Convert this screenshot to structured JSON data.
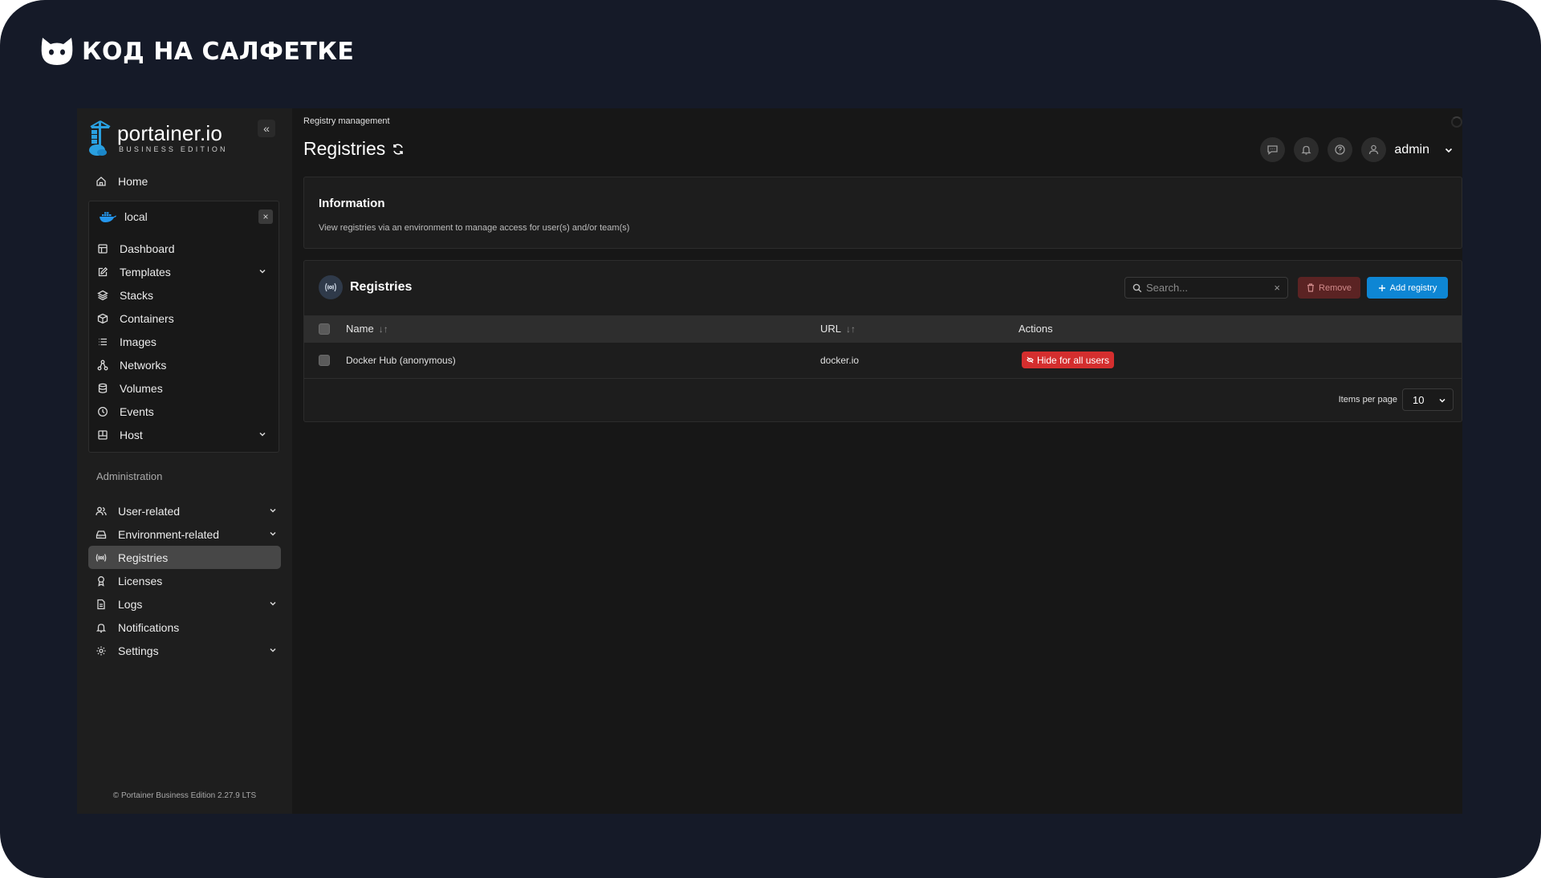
{
  "brand": {
    "text": "КОД НА САЛФЕТКЕ"
  },
  "sidebar": {
    "logo_name": "portainer.io",
    "logo_edition": "BUSINESS EDITION",
    "collapse_icon": "«",
    "home": "Home",
    "environment": {
      "name": "local",
      "close_icon": "×",
      "items": [
        {
          "label": "Dashboard",
          "icon": "dashboard-icon",
          "expandable": false
        },
        {
          "label": "Templates",
          "icon": "edit-icon",
          "expandable": true
        },
        {
          "label": "Stacks",
          "icon": "layers-icon",
          "expandable": false
        },
        {
          "label": "Containers",
          "icon": "box-icon",
          "expandable": false
        },
        {
          "label": "Images",
          "icon": "list-icon",
          "expandable": false
        },
        {
          "label": "Networks",
          "icon": "network-icon",
          "expandable": false
        },
        {
          "label": "Volumes",
          "icon": "database-icon",
          "expandable": false
        },
        {
          "label": "Events",
          "icon": "clock-icon",
          "expandable": false
        },
        {
          "label": "Host",
          "icon": "host-icon",
          "expandable": true
        }
      ]
    },
    "admin_label": "Administration",
    "admin_items": [
      {
        "label": "User-related",
        "icon": "users-icon",
        "expandable": true
      },
      {
        "label": "Environment-related",
        "icon": "drive-icon",
        "expandable": true
      },
      {
        "label": "Registries",
        "icon": "radio-icon",
        "expandable": false,
        "active": true
      },
      {
        "label": "Licenses",
        "icon": "award-icon",
        "expandable": false
      },
      {
        "label": "Logs",
        "icon": "file-icon",
        "expandable": true
      },
      {
        "label": "Notifications",
        "icon": "bell-icon",
        "expandable": false
      },
      {
        "label": "Settings",
        "icon": "gear-icon",
        "expandable": true
      }
    ],
    "footer": "© Portainer Business Edition 2.27.9 LTS"
  },
  "header": {
    "breadcrumb": "Registry management",
    "title": "Registries",
    "user": "admin"
  },
  "info": {
    "title": "Information",
    "text": "View registries via an environment to manage access for user(s) and/or team(s)"
  },
  "registries": {
    "title": "Registries",
    "search_placeholder": "Search...",
    "clear_icon": "×",
    "remove_label": "Remove",
    "add_label": "Add registry",
    "columns": {
      "name": "Name",
      "url": "URL",
      "actions": "Actions"
    },
    "sort_glyph": "↓↑",
    "rows": [
      {
        "name": "Docker Hub (anonymous)",
        "url": "docker.io",
        "action": "Hide for all users"
      }
    ],
    "items_per_page_label": "Items per page",
    "items_per_page": "10"
  },
  "colors": {
    "accent": "#0e86d4",
    "danger": "#d42e2e",
    "background": "#151a28"
  }
}
